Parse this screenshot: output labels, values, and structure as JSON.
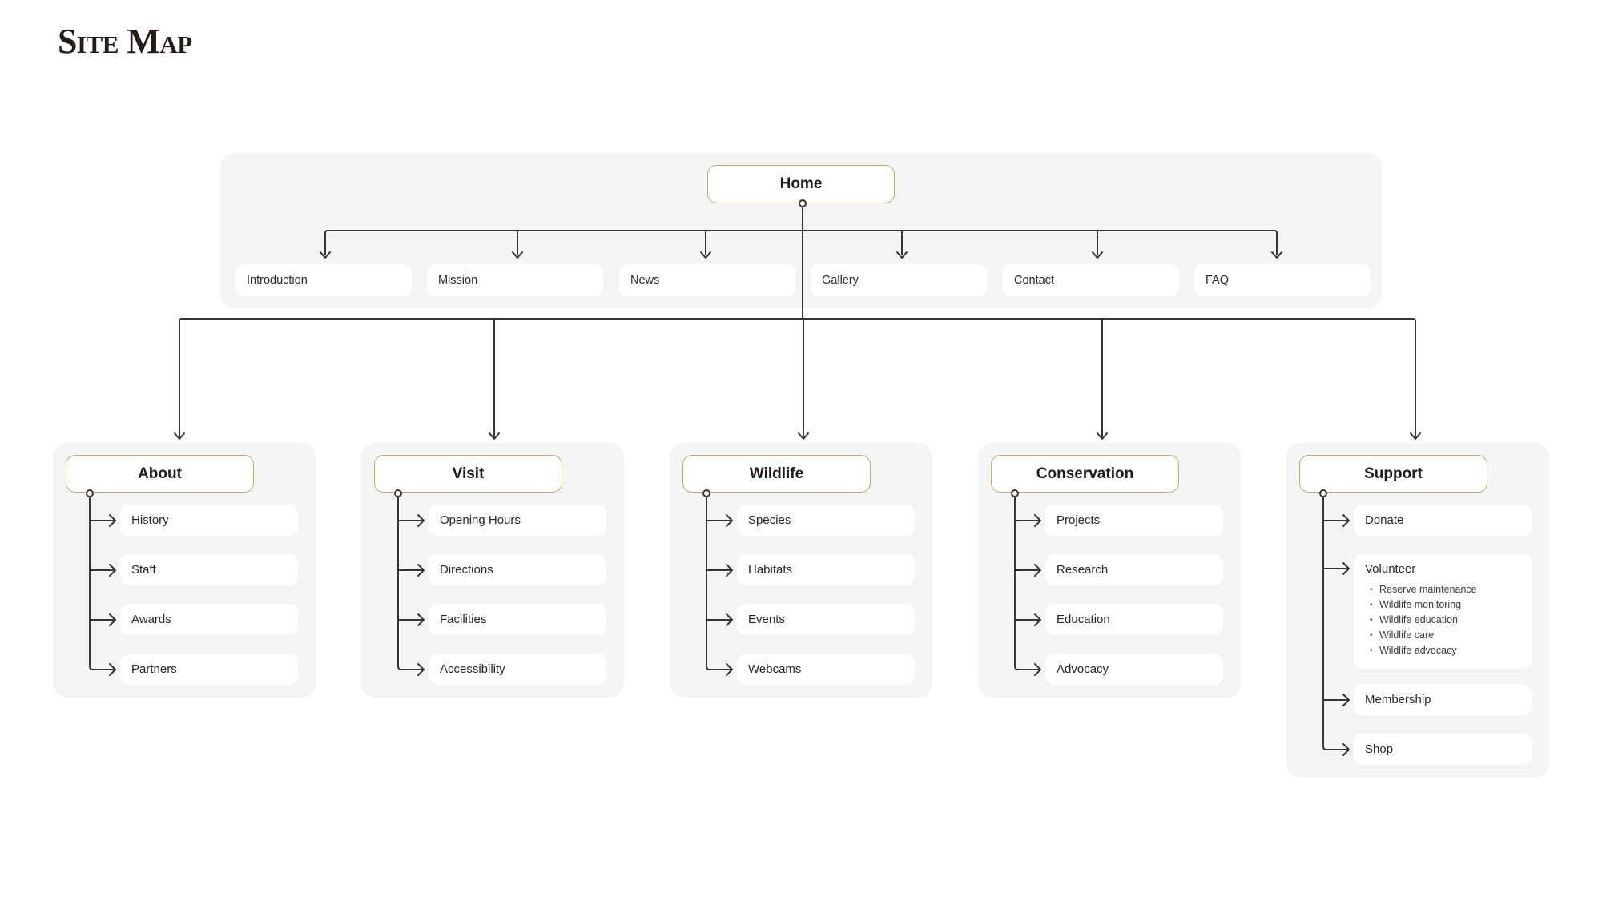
{
  "title": "Site Map",
  "colors": {
    "panel_bg": "#f4f4f4",
    "hub_border": "#c9a96e",
    "connector": "#3a3330",
    "text": "#1f1a17"
  },
  "root": {
    "label": "Home",
    "children": [
      "Introduction",
      "Mission",
      "News",
      "Gallery",
      "Contact",
      "FAQ"
    ]
  },
  "sections": [
    {
      "label": "About",
      "items": [
        {
          "label": "History"
        },
        {
          "label": "Staff"
        },
        {
          "label": "Awards"
        },
        {
          "label": "Partners"
        }
      ]
    },
    {
      "label": "Visit",
      "items": [
        {
          "label": "Opening Hours"
        },
        {
          "label": "Directions"
        },
        {
          "label": "Facilities"
        },
        {
          "label": "Accessibility"
        }
      ]
    },
    {
      "label": "Wildlife",
      "items": [
        {
          "label": "Species"
        },
        {
          "label": "Habitats"
        },
        {
          "label": "Events"
        },
        {
          "label": "Webcams"
        }
      ]
    },
    {
      "label": "Conservation",
      "items": [
        {
          "label": "Projects"
        },
        {
          "label": "Research"
        },
        {
          "label": "Education"
        },
        {
          "label": "Advocacy"
        }
      ]
    },
    {
      "label": "Support",
      "items": [
        {
          "label": "Donate"
        },
        {
          "label": "Volunteer",
          "sub": [
            "Reserve maintenance",
            "Wildlife monitoring",
            "Wildlife education",
            "Wildlife care",
            "Wildlife advocacy"
          ]
        },
        {
          "label": "Membership"
        },
        {
          "label": "Shop"
        }
      ]
    }
  ]
}
